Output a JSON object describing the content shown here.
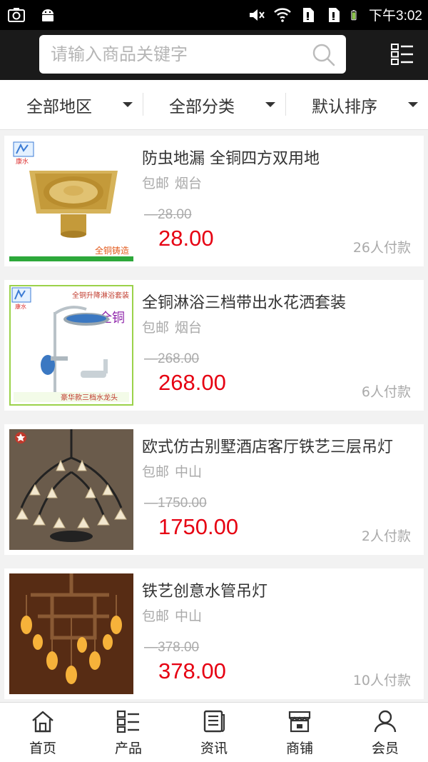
{
  "status_bar": {
    "left_icons": [
      "screenshot-icon",
      "android-icon"
    ],
    "right_icons": [
      "mute-icon",
      "wifi-icon",
      "sim1-icon",
      "sim2-icon",
      "battery-icon"
    ],
    "time": "下午3:02"
  },
  "search": {
    "placeholder": "请输入商品关键字",
    "value": ""
  },
  "filters": [
    {
      "label": "全部地区"
    },
    {
      "label": "全部分类"
    },
    {
      "label": "默认排序"
    }
  ],
  "products": [
    {
      "title": "防虫地漏 全铜四方双用地",
      "shipping": "包邮",
      "location": "烟台",
      "old_price": "28.00",
      "price": "28.00",
      "sold": "26人付款",
      "image_caption": "全铜铸造",
      "brand": "康水"
    },
    {
      "title": "全铜淋浴三档带出水花洒套装",
      "shipping": "包邮",
      "location": "烟台",
      "old_price": "268.00",
      "price": "268.00",
      "sold": "6人付款",
      "image_caption": "全铜升降淋浴套装",
      "image_tag": "全铜",
      "image_footer": "豪华款三档水龙头",
      "brand": "康水"
    },
    {
      "title": "欧式仿古别墅酒店客厅铁艺三层吊灯",
      "shipping": "包邮",
      "location": "中山",
      "old_price": "1750.00",
      "price": "1750.00",
      "sold": "2人付款"
    },
    {
      "title": "铁艺创意水管吊灯",
      "shipping": "包邮",
      "location": "中山",
      "old_price": "378.00",
      "price": "378.00",
      "sold": "10人付款"
    }
  ],
  "tabs": [
    {
      "label": "首页",
      "icon": "home-icon"
    },
    {
      "label": "产品",
      "icon": "products-icon"
    },
    {
      "label": "资讯",
      "icon": "news-icon"
    },
    {
      "label": "商铺",
      "icon": "shop-icon"
    },
    {
      "label": "会员",
      "icon": "member-icon"
    }
  ],
  "colors": {
    "header_bg": "#1a1a1a",
    "price_red": "#e60012",
    "muted_text": "#aaaaaa"
  }
}
